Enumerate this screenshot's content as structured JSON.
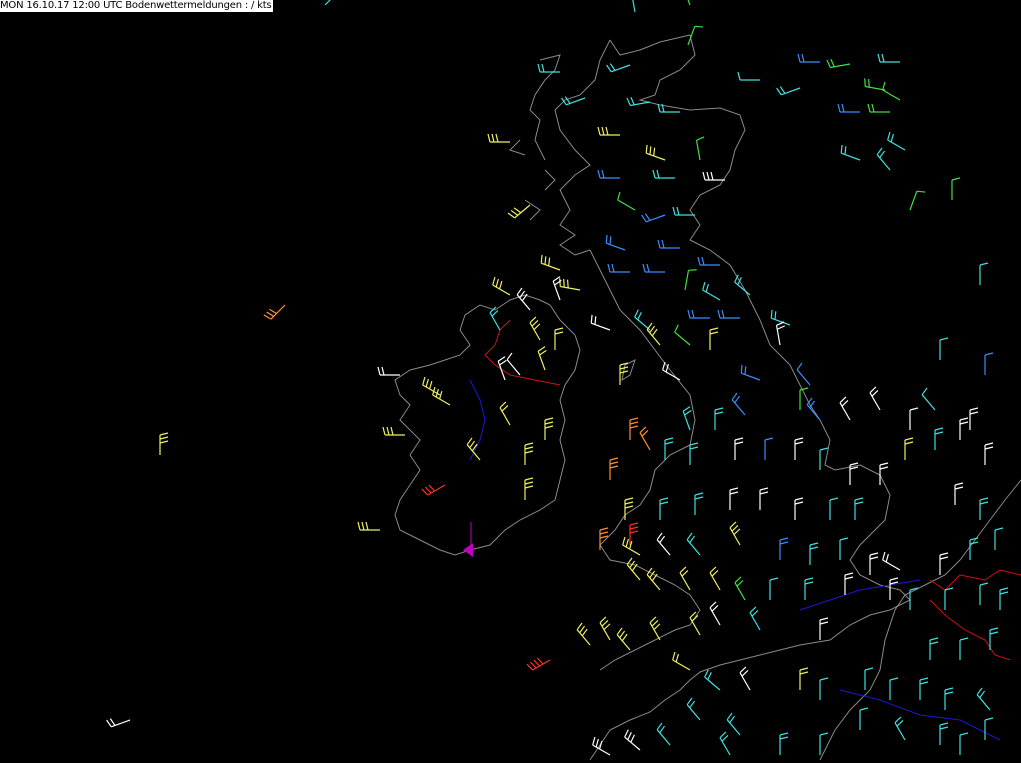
{
  "header": {
    "title": "MON 16.10.17 12:00 UTC  Bodenwettermeldungen : / kts"
  },
  "colors": {
    "background": "#000000",
    "coastline": "#8a8a8a",
    "border_red": "#d01010",
    "border_blue": "#1a1ad0",
    "marker": "#c000c0",
    "wind_white": "#ffffff",
    "wind_yellow": "#f0f060",
    "wind_cyan": "#40e0e0",
    "wind_blue": "#3a8cff",
    "wind_green": "#40e040",
    "wind_orange": "#ff9030",
    "wind_red": "#ff3020"
  },
  "map": {
    "region": "British Isles",
    "wind_barbs": [
      {
        "label": "w1",
        "color": "wind_cyan"
      },
      {
        "label": "w2",
        "color": "wind_yellow"
      }
    ]
  }
}
